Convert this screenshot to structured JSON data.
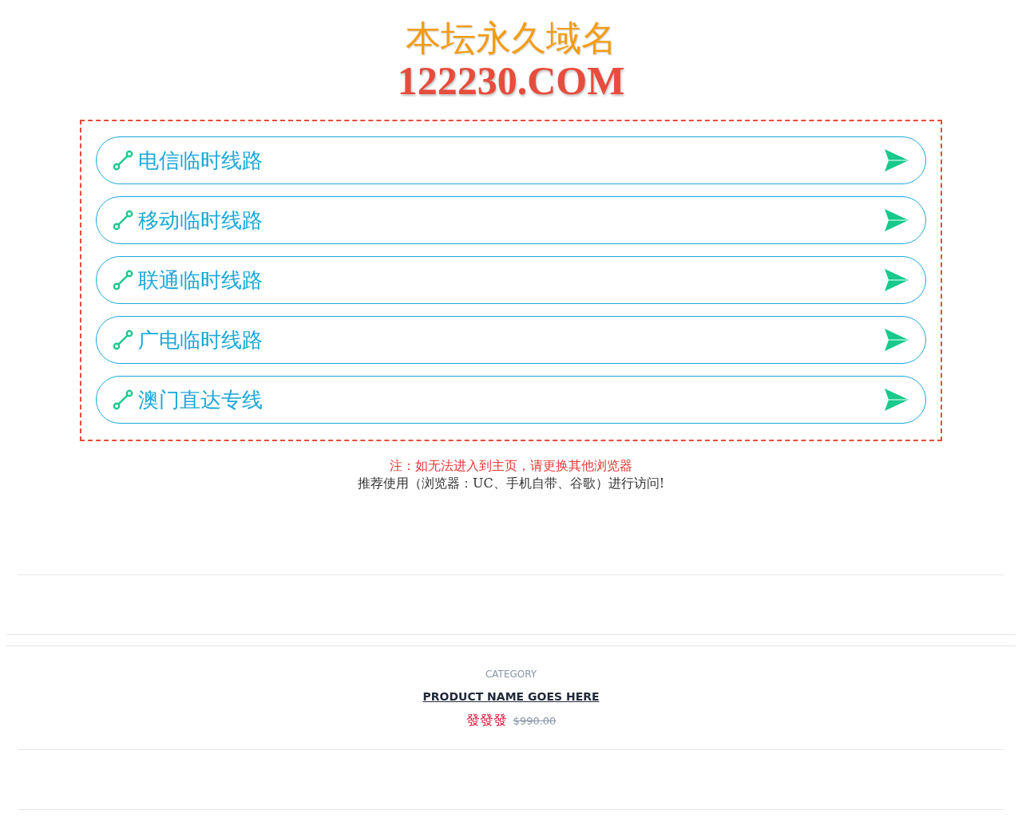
{
  "header": {
    "title": "本坛永久域名",
    "domain": "122230.COM"
  },
  "links": [
    {
      "label": "电信临时线路"
    },
    {
      "label": "移动临时线路"
    },
    {
      "label": "联通临时线路"
    },
    {
      "label": "广电临时线路"
    },
    {
      "label": "澳门直达专线"
    }
  ],
  "notice": {
    "warning": "注：如无法进入到主页，请更换其他浏览器",
    "advice": "推荐使用（浏览器：UC、手机自带、谷歌）进行访问!"
  },
  "product": {
    "category": "CATEGORY",
    "name": "PRODUCT NAME GOES HERE",
    "price": "發發發",
    "old_price": "$990.00"
  }
}
